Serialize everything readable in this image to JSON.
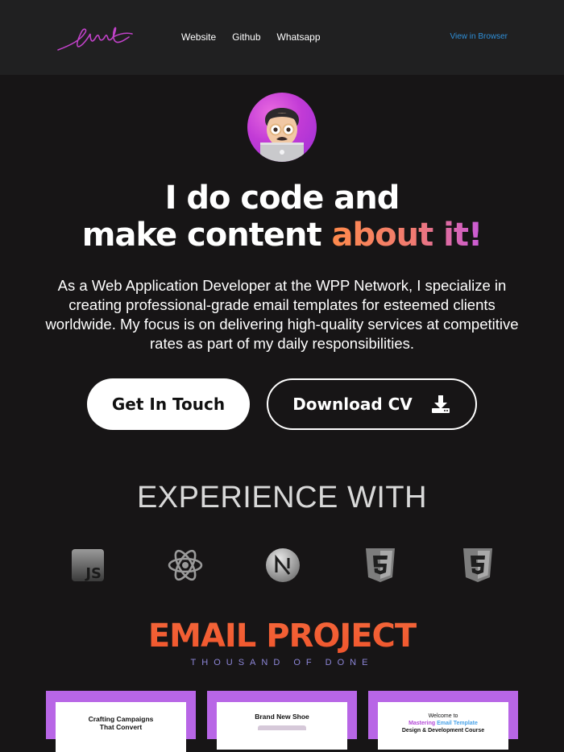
{
  "header": {
    "logo_alt": "signature logo",
    "nav": [
      "Website",
      "Github",
      "Whatsapp"
    ],
    "view_in_browser": "View in Browser"
  },
  "hero": {
    "headline_line1": "I do code and",
    "headline_line2_plain": "make content ",
    "headline_line2_accent": "about it!",
    "bio": "As a Web Application Developer at the WPP Network, I specialize in creating professional-grade email templates for esteemed clients worldwide. My focus is on delivering high-quality services at competitive rates as part of my daily responsibilities.",
    "buttons": {
      "touch": "Get In Touch",
      "cv": "Download CV"
    }
  },
  "experience": {
    "title": "EXPERIENCE WITH",
    "icons": [
      "javascript-icon",
      "react-icon",
      "nextjs-icon",
      "html5-icon",
      "css3-icon"
    ]
  },
  "projects": {
    "title": "EMAIL PROJECT",
    "subtitle": "THOUSAND OF DONE",
    "cards": [
      {
        "line1": "Crafting Campaigns",
        "line2": "That Convert"
      },
      {
        "line1": "Brand New Shoe"
      },
      {
        "pre": "Welcome to",
        "hl_a": "Mastering ",
        "hl_b": "Email Template",
        "line2": "Design & Development Course"
      }
    ]
  },
  "colors": {
    "accent_orange": "#ff8a4c",
    "accent_purple": "#c95ad9",
    "link_blue": "#2f8fd8",
    "card_purple": "#b866e6"
  }
}
